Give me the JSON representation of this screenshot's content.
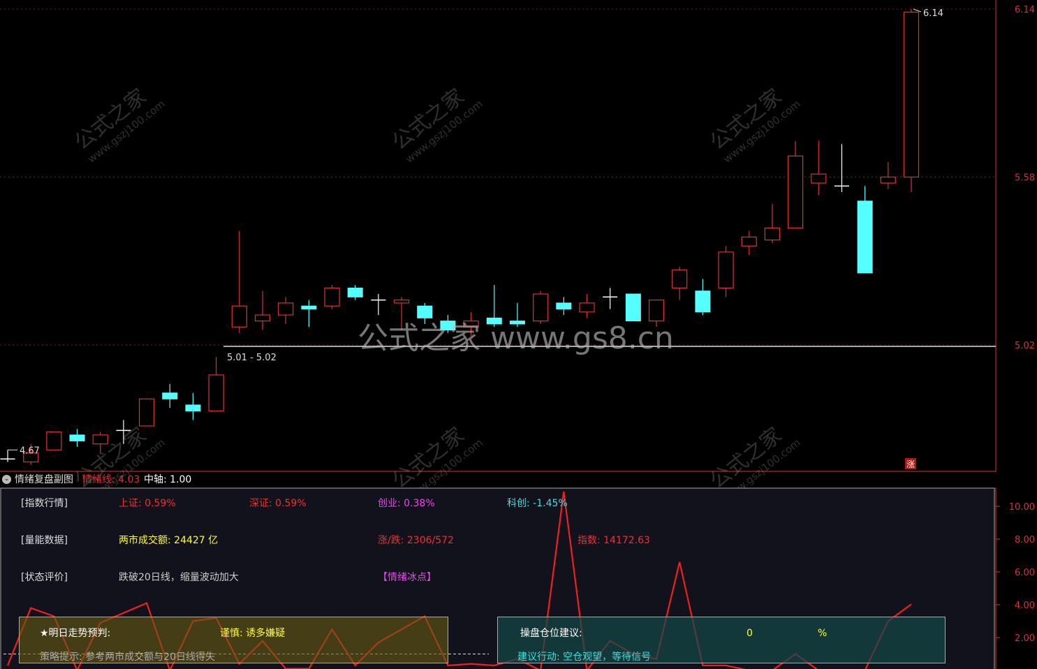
{
  "colors": {
    "up": "#e03030",
    "down": "#55ffff",
    "doji": "#ffffff",
    "grid": "#7a1a1a",
    "axis": "#e03030",
    "emotion_line": "#ee2020"
  },
  "main": {
    "price_labels": [
      "6.14",
      "5.58",
      "5.02"
    ],
    "high_label": "6.14",
    "low_label": "4.67",
    "range_label": "5.01 - 5.02",
    "limit_badge": "涨",
    "watermark_big": "公式之家 www.gs8.cn",
    "watermark_small_title": "公式之家",
    "watermark_small_url": "www.gszj100.com",
    "candles": [
      {
        "o": 4.63,
        "h": 4.67,
        "l": 4.63,
        "c": 4.65,
        "t": "doji"
      },
      {
        "o": 4.63,
        "h": 4.69,
        "l": 4.62,
        "c": 4.66,
        "t": "up"
      },
      {
        "o": 4.67,
        "h": 4.73,
        "l": 4.67,
        "c": 4.73,
        "t": "up"
      },
      {
        "o": 4.72,
        "h": 4.74,
        "l": 4.68,
        "c": 4.7,
        "t": "down"
      },
      {
        "o": 4.69,
        "h": 4.73,
        "l": 4.66,
        "c": 4.72,
        "t": "up"
      },
      {
        "o": 4.74,
        "h": 4.77,
        "l": 4.69,
        "c": 4.73,
        "t": "doji"
      },
      {
        "o": 4.75,
        "h": 4.84,
        "l": 4.75,
        "c": 4.84,
        "t": "up"
      },
      {
        "o": 4.86,
        "h": 4.89,
        "l": 4.81,
        "c": 4.84,
        "t": "down"
      },
      {
        "o": 4.82,
        "h": 4.86,
        "l": 4.77,
        "c": 4.8,
        "t": "down"
      },
      {
        "o": 4.8,
        "h": 4.98,
        "l": 4.8,
        "c": 4.92,
        "t": "up"
      },
      {
        "o": 5.08,
        "h": 5.4,
        "l": 5.06,
        "c": 5.15,
        "t": "up"
      },
      {
        "o": 5.1,
        "h": 5.2,
        "l": 5.07,
        "c": 5.12,
        "t": "up"
      },
      {
        "o": 5.12,
        "h": 5.18,
        "l": 5.09,
        "c": 5.16,
        "t": "up"
      },
      {
        "o": 5.15,
        "h": 5.17,
        "l": 5.08,
        "c": 5.14,
        "t": "down"
      },
      {
        "o": 5.15,
        "h": 5.22,
        "l": 5.14,
        "c": 5.21,
        "t": "up"
      },
      {
        "o": 5.21,
        "h": 5.22,
        "l": 5.17,
        "c": 5.18,
        "t": "down"
      },
      {
        "o": 5.17,
        "h": 5.19,
        "l": 5.12,
        "c": 5.17,
        "t": "doji"
      },
      {
        "o": 5.17,
        "h": 5.18,
        "l": 5.07,
        "c": 5.16,
        "t": "up"
      },
      {
        "o": 5.15,
        "h": 5.16,
        "l": 5.09,
        "c": 5.11,
        "t": "down"
      },
      {
        "o": 5.1,
        "h": 5.12,
        "l": 5.06,
        "c": 5.07,
        "t": "down"
      },
      {
        "o": 5.08,
        "h": 5.13,
        "l": 5.05,
        "c": 5.1,
        "t": "up"
      },
      {
        "o": 5.11,
        "h": 5.22,
        "l": 5.08,
        "c": 5.09,
        "t": "down"
      },
      {
        "o": 5.1,
        "h": 5.16,
        "l": 5.08,
        "c": 5.09,
        "t": "down"
      },
      {
        "o": 5.1,
        "h": 5.2,
        "l": 5.09,
        "c": 5.19,
        "t": "up"
      },
      {
        "o": 5.16,
        "h": 5.18,
        "l": 5.12,
        "c": 5.14,
        "t": "down"
      },
      {
        "o": 5.13,
        "h": 5.19,
        "l": 5.11,
        "c": 5.16,
        "t": "up"
      },
      {
        "o": 5.18,
        "h": 5.21,
        "l": 5.14,
        "c": 5.18,
        "t": "doji"
      },
      {
        "o": 5.19,
        "h": 5.19,
        "l": 5.1,
        "c": 5.1,
        "t": "down"
      },
      {
        "o": 5.1,
        "h": 5.17,
        "l": 5.08,
        "c": 5.17,
        "t": "up"
      },
      {
        "o": 5.21,
        "h": 5.28,
        "l": 5.17,
        "c": 5.27,
        "t": "up"
      },
      {
        "o": 5.2,
        "h": 5.24,
        "l": 5.12,
        "c": 5.13,
        "t": "down"
      },
      {
        "o": 5.21,
        "h": 5.35,
        "l": 5.18,
        "c": 5.33,
        "t": "up"
      },
      {
        "o": 5.35,
        "h": 5.4,
        "l": 5.32,
        "c": 5.38,
        "t": "up"
      },
      {
        "o": 5.37,
        "h": 5.49,
        "l": 5.36,
        "c": 5.41,
        "t": "up"
      },
      {
        "o": 5.41,
        "h": 5.7,
        "l": 5.41,
        "c": 5.65,
        "t": "up"
      },
      {
        "o": 5.56,
        "h": 5.7,
        "l": 5.52,
        "c": 5.59,
        "t": "up"
      },
      {
        "o": 5.55,
        "h": 5.69,
        "l": 5.53,
        "c": 5.55,
        "t": "doji"
      },
      {
        "o": 5.5,
        "h": 5.55,
        "l": 5.26,
        "c": 5.26,
        "t": "down"
      },
      {
        "o": 5.56,
        "h": 5.63,
        "l": 5.54,
        "c": 5.58,
        "t": "up"
      },
      {
        "o": 5.58,
        "h": 6.14,
        "l": 5.53,
        "c": 6.13,
        "t": "up"
      }
    ]
  },
  "sub": {
    "title": "情绪复盘副图",
    "emotion_label": "情绪线: 4.03",
    "axis_label": "中轴: 1.00",
    "axis_ticks": [
      "10.00",
      "8.00",
      "6.00",
      "4.00",
      "2.00"
    ],
    "emotion_values": [
      0.3,
      3.8,
      3.3,
      0.0,
      2.9,
      3.5,
      4.1,
      0.0,
      3.0,
      3.2,
      0.4,
      1.8,
      0.1,
      0.1,
      2.5,
      0.3,
      1.7,
      2.5,
      3.3,
      0.3,
      0.4,
      0.3,
      0.7,
      0.0,
      10.9,
      0.0,
      1.8,
      1.0,
      0.7,
      6.6,
      0.3,
      0.3,
      0.0,
      0.0,
      1.0,
      0.0,
      -0.2,
      0.0,
      3.0,
      4.03
    ],
    "rows": [
      {
        "label": "[指数行情]",
        "a": "上证: 0.59%",
        "b": "深证: 0.59%",
        "c": "创业: 0.38%",
        "d": "科创: -1.45%"
      },
      {
        "label": "[量能数据]",
        "a": "两市成交额: 24427 亿",
        "b": "涨/跌: 2306/572",
        "c": "指数: 14172.63"
      },
      {
        "label": "[状态评价]",
        "a": "跌破20日线，缩量波动加大",
        "b": "【情绪冰点】"
      }
    ],
    "forecast_label": "★明日走势预判:",
    "forecast_value": "谨慎: 诱多嫌疑",
    "strategy_text": "策略提示: 参考两市成交额与20日线得失",
    "position_label": "操盘仓位建议:",
    "position_value": "0",
    "position_unit": "%",
    "action_text": "建议行动: 空仓观望，等待信号"
  }
}
